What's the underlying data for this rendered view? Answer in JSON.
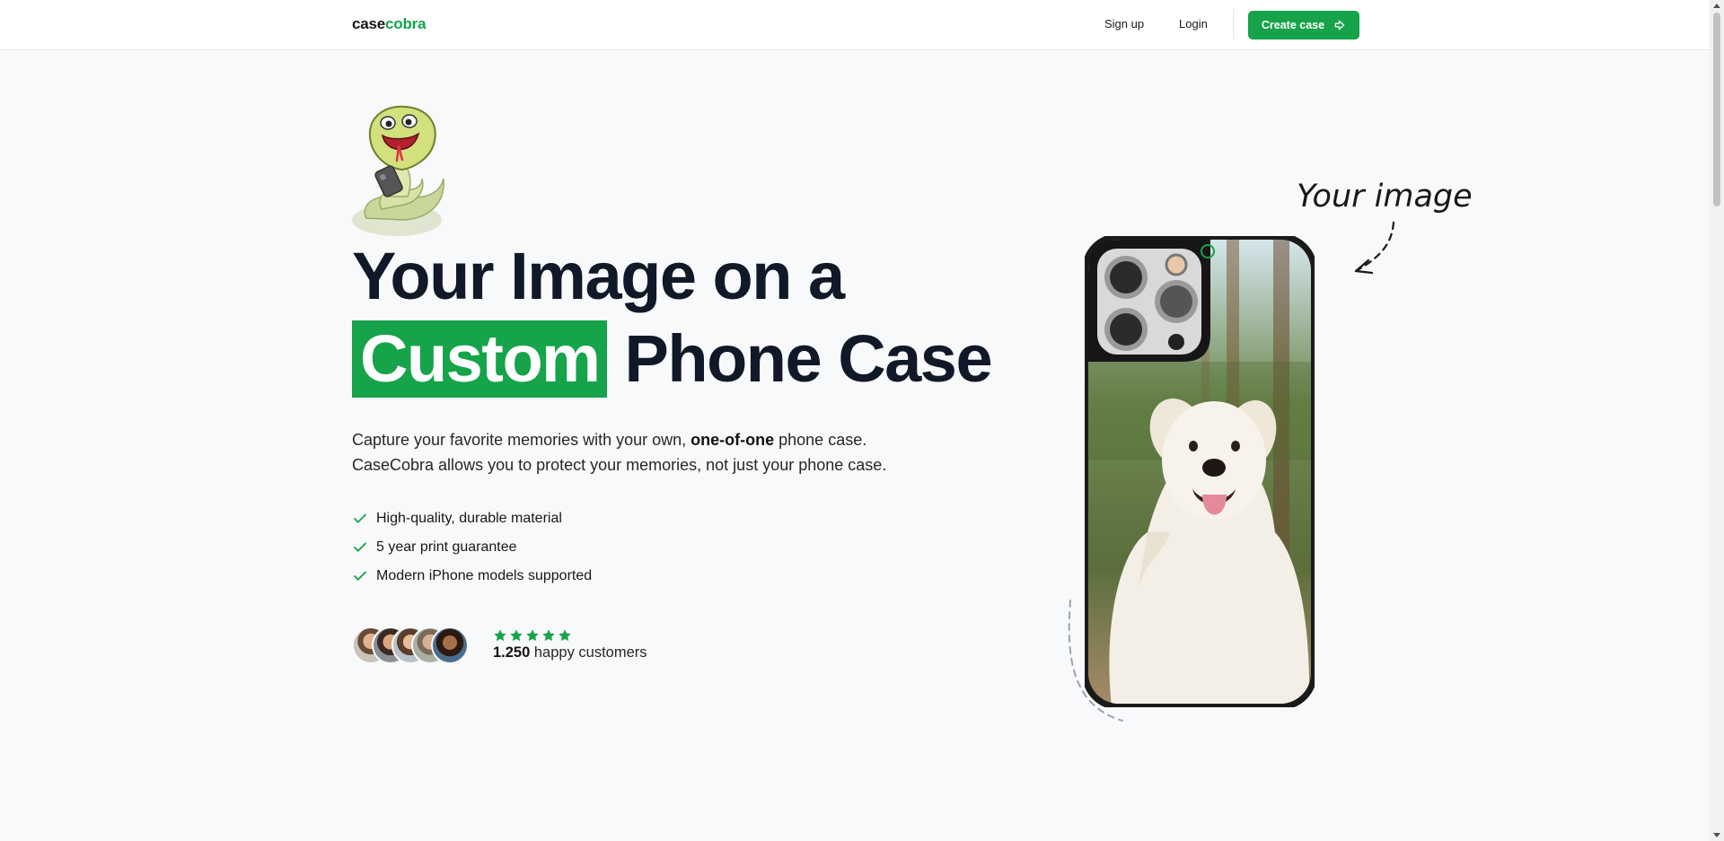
{
  "nav": {
    "logo_main": "case",
    "logo_accent": "cobra",
    "signup": "Sign up",
    "login": "Login",
    "create_case": "Create case",
    "create_case_icon": "arrow-right-icon"
  },
  "hero": {
    "headline_line1": "Your Image on a",
    "headline_highlight": "Custom",
    "headline_line2_rest": " Phone Case",
    "desc_part1": "Capture your favorite memories with your own, ",
    "desc_bold": "one-of-one",
    "desc_part2": " phone case.",
    "desc_line2": "CaseCobra allows you to protect your memories, not just your phone case.",
    "features": [
      "High-quality, durable material",
      "5 year print guarantee",
      "Modern iPhone models supported"
    ],
    "rating_stars": 5,
    "customers_count": "1.250",
    "customers_label": " happy customers"
  },
  "showcase": {
    "annotation": "Your image"
  },
  "colors": {
    "accent": "#16a34a",
    "heading": "#111827",
    "background": "#f8f9fa"
  }
}
